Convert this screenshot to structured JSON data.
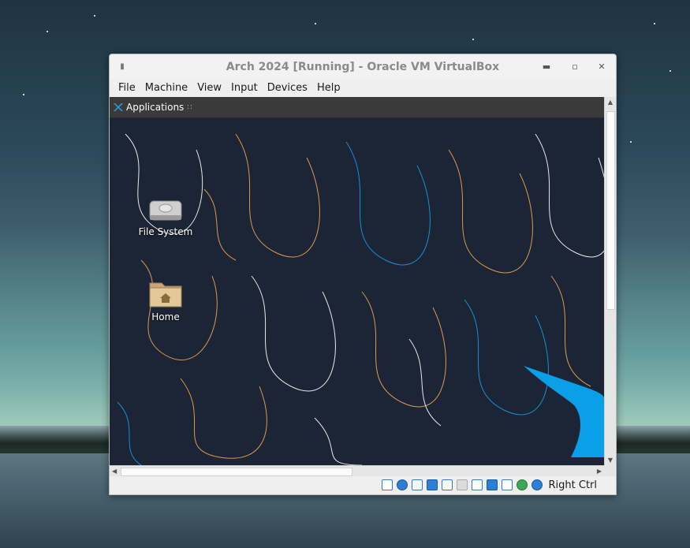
{
  "window": {
    "title": "Arch 2024 [Running] - Oracle VM VirtualBox",
    "menu": [
      "File",
      "Machine",
      "View",
      "Input",
      "Devices",
      "Help"
    ]
  },
  "guest": {
    "panel": {
      "applications_label": "Applications",
      "grip": "∷"
    },
    "desktop_icons": [
      {
        "label": "File System",
        "icon": "drive-icon"
      },
      {
        "label": "Home",
        "icon": "home-folder-icon"
      }
    ],
    "wallpaper": {
      "background": "#1c2535",
      "line_colors": [
        "#d99a4e",
        "#1a8fd0",
        "#e8e8e8"
      ],
      "logo_color": "#0a9fe6"
    }
  },
  "statusbar": {
    "icons": [
      "hard-disk-icon",
      "optical-disk-icon",
      "audio-icon",
      "network-icon",
      "usb-icon",
      "shared-folders-icon",
      "display-icon",
      "video-capture-icon",
      "mouse-integration-icon",
      "cpu-virtualization-icon",
      "guest-additions-icon",
      "host-key-indicator-icon"
    ],
    "host_key": "Right Ctrl"
  }
}
